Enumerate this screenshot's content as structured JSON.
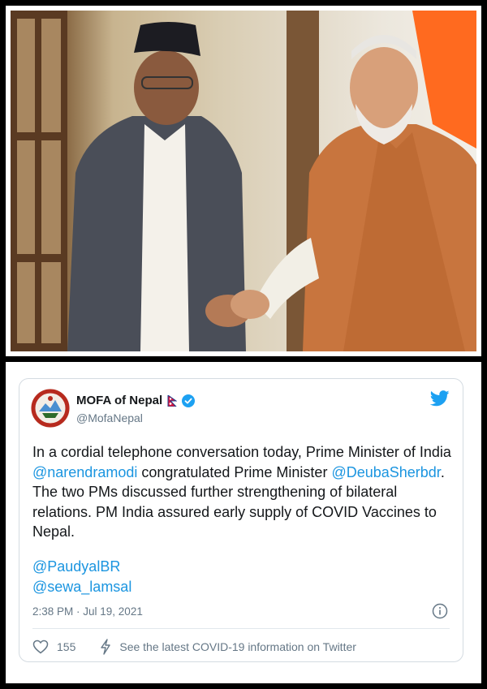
{
  "tweet": {
    "display_name": "MOFA of Nepal",
    "handle": "@MofaNepal",
    "body_parts": [
      {
        "text": "In a cordial telephone conversation today, Prime Minister of India ",
        "type": "text"
      },
      {
        "text": "@narendramodi",
        "type": "mention"
      },
      {
        "text": " congratulated Prime Minister ",
        "type": "text"
      },
      {
        "text": "@DeubaSherbdr",
        "type": "mention"
      },
      {
        "text": ". The two PMs discussed further strengthening of bilateral relations. PM India assured early supply of COVID Vaccines to Nepal.",
        "type": "text"
      }
    ],
    "mentions": [
      "@PaudyalBR",
      "@sewa_lamsal"
    ],
    "timestamp": "2:38 PM · Jul 19, 2021",
    "like_count": "155",
    "covid_notice": "See the latest COVID-19 information on Twitter"
  },
  "colors": {
    "link": "#1b95e0",
    "verified": "#1da1f2",
    "secondary_text": "#657786"
  }
}
